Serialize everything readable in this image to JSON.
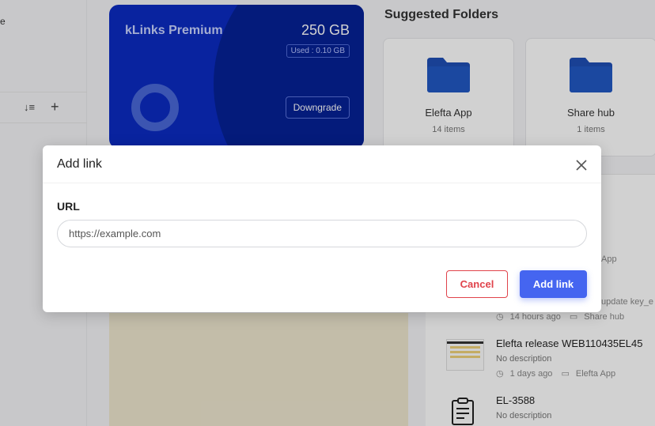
{
  "sidebar": {
    "fragment_text": "e",
    "sort_icon": "sort-icon",
    "add_icon": "plus-icon"
  },
  "premium_card": {
    "title": "kLinks Premium",
    "storage": "250 GB",
    "used": "Used : 0.10 GB",
    "downgrade_label": "Downgrade",
    "colors": {
      "background": "#0b2bc2",
      "circle": "#062297"
    }
  },
  "suggested": {
    "heading": "Suggested Folders",
    "folders": [
      {
        "name": "Elefta App",
        "count": "14 items"
      },
      {
        "name": "Share hub",
        "count": "1 items"
      }
    ]
  },
  "links": {
    "fragments": [
      "App",
      "update key_e"
    ],
    "meta_partial": {
      "time": "14 hours ago",
      "folder": "Share hub"
    },
    "items": [
      {
        "title": "Elefta release WEB110435EL45",
        "description": "No description",
        "time": "1 days ago",
        "folder": "Elefta App"
      },
      {
        "title": "EL-3588",
        "description": "No description"
      }
    ]
  },
  "modal": {
    "title": "Add link",
    "field_label": "URL",
    "url_placeholder": "https://example.com",
    "url_value": "",
    "cancel_label": "Cancel",
    "add_label": "Add link",
    "colors": {
      "primary": "#4565f0",
      "danger": "#e0434b"
    }
  }
}
